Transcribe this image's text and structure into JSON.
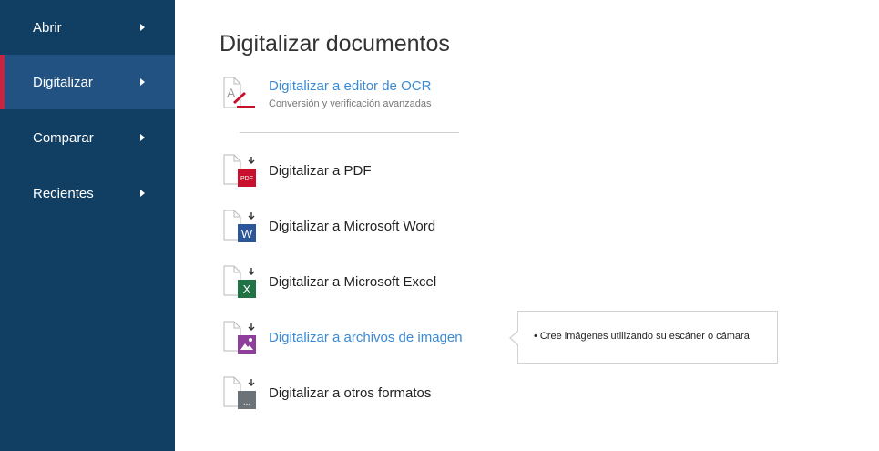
{
  "sidebar": {
    "items": [
      {
        "label": "Abrir"
      },
      {
        "label": "Digitalizar",
        "active": true
      },
      {
        "label": "Comparar"
      },
      {
        "label": "Recientes"
      }
    ]
  },
  "main": {
    "title": "Digitalizar documentos",
    "ocr_item": {
      "label": "Digitalizar a editor de OCR",
      "sublabel": "Conversión y verificación avanzadas"
    },
    "items": [
      {
        "label": "Digitalizar a PDF",
        "icon": "pdf-icon",
        "badge": "PDF",
        "color": "#c8102e"
      },
      {
        "label": "Digitalizar a Microsoft Word",
        "icon": "word-icon",
        "badge": "W",
        "color": "#2b579a"
      },
      {
        "label": "Digitalizar a Microsoft Excel",
        "icon": "excel-icon",
        "badge": "X",
        "color": "#217346"
      },
      {
        "label": "Digitalizar a archivos de imagen",
        "icon": "image-icon",
        "color": "#8e3f9c"
      },
      {
        "label": "Digitalizar a otros formatos",
        "icon": "other-formats-icon",
        "badge": "...",
        "color": "#6b7378"
      }
    ]
  },
  "tooltip": {
    "text": "• Cree imágenes utilizando su escáner o cámara"
  },
  "colors": {
    "sidebar_bg": "#113f63",
    "sidebar_active_bg": "#225281",
    "active_accent": "#c8243f",
    "link": "#3b8ad4"
  }
}
